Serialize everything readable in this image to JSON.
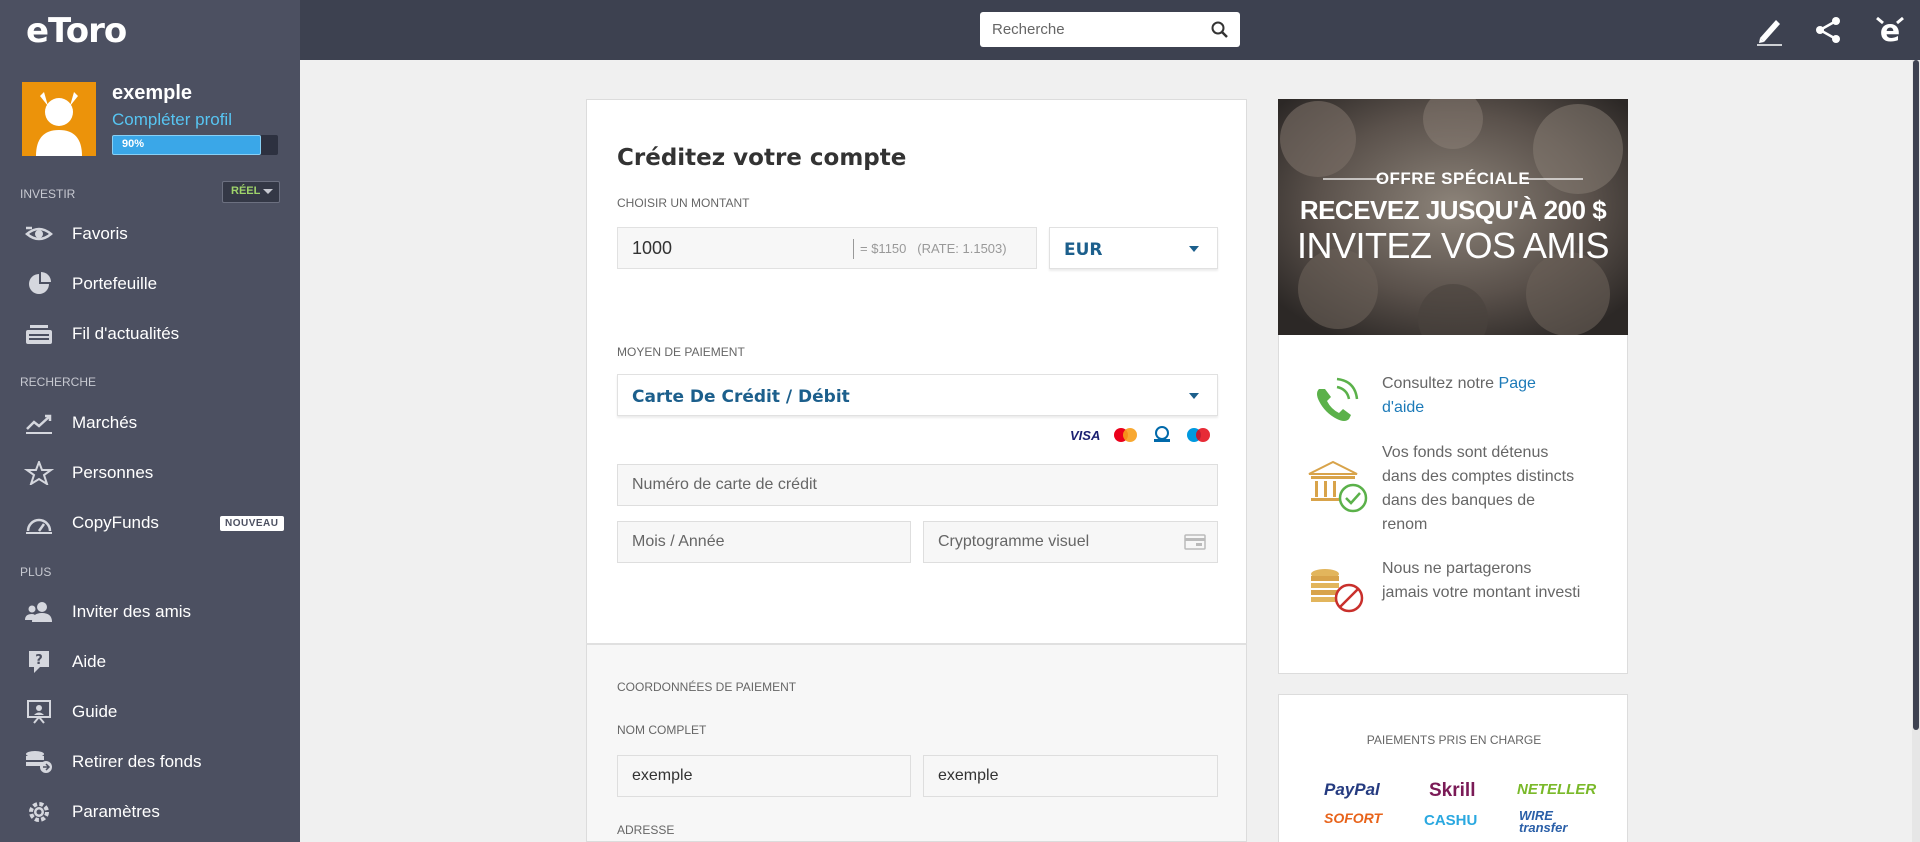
{
  "brand": {
    "logo_text": "eToro"
  },
  "user": {
    "name": "exemple",
    "complete_profile": "Compléter profil",
    "progress_label": "90%",
    "progress": 0.9
  },
  "sidebar": {
    "section_invest": "INVESTIR",
    "mode": "RÉEL",
    "section_research": "RECHERCHE",
    "section_more": "PLUS",
    "items": [
      {
        "label": "Favoris",
        "icon": "eye-icon"
      },
      {
        "label": "Portefeuille",
        "icon": "pie-chart-icon"
      },
      {
        "label": "Fil d'actualités",
        "icon": "news-feed-icon"
      },
      {
        "label": "Marchés",
        "icon": "trend-chart-icon"
      },
      {
        "label": "Personnes",
        "icon": "star-icon"
      },
      {
        "label": "CopyFunds",
        "icon": "copyfunds-icon",
        "badge": "NOUVEAU"
      },
      {
        "label": "Inviter des amis",
        "icon": "invite-friends-icon"
      },
      {
        "label": "Aide",
        "icon": "help-icon"
      },
      {
        "label": "Guide",
        "icon": "guide-icon"
      },
      {
        "label": "Retirer des fonds",
        "icon": "withdraw-icon"
      },
      {
        "label": "Paramètres",
        "icon": "gear-icon"
      }
    ]
  },
  "topbar": {
    "search_placeholder": "Recherche"
  },
  "deposit": {
    "title": "Créditez votre compte",
    "amount_label": "CHOISIR UN MONTANT",
    "amount_value": "1000",
    "conversion": "= $1150",
    "rate": "(RATE: 1.1503)",
    "currency": "EUR",
    "payment_method_label": "MOYEN DE PAIEMENT",
    "payment_method": "Carte De Crédit / Débit",
    "card_brands": [
      "VISA",
      "MasterCard",
      "Diners Club",
      "Maestro"
    ],
    "card_number_placeholder": "Numéro de carte de crédit",
    "expiry_placeholder": "Mois / Année",
    "cvv_placeholder": "Cryptogramme visuel"
  },
  "billing": {
    "section_label": "COORDONNÉES DE PAIEMENT",
    "full_name_label": "NOM COMPLET",
    "first_name": "exemple",
    "last_name": "exemple",
    "address_label": "ADRESSE"
  },
  "promo": {
    "offer": "OFFRE SPÉCIALE",
    "line1": "RECEVEZ JUSQU'À 200 $",
    "line2": "INVITEZ VOS AMIS"
  },
  "info": {
    "help_prefix": "Consultez notre",
    "help_link": "Page d'aide",
    "funds_text": "Vos fonds sont détenus dans des comptes distincts dans des banques de renom",
    "privacy_text": "Nous ne partagerons jamais votre montant investi"
  },
  "payments": {
    "title": "PAIEMENTS PRIS EN CHARGE",
    "methods": [
      "PayPal",
      "Skrill",
      "NETELLER",
      "SOFORT",
      "CASHU",
      "WIRE transfer"
    ]
  },
  "colors": {
    "sidebar": "#4c5061",
    "topbar": "#3d4150",
    "accent_blue": "#1c5f8c",
    "link_cyan": "#57c5f2",
    "green": "#5bb14a"
  }
}
